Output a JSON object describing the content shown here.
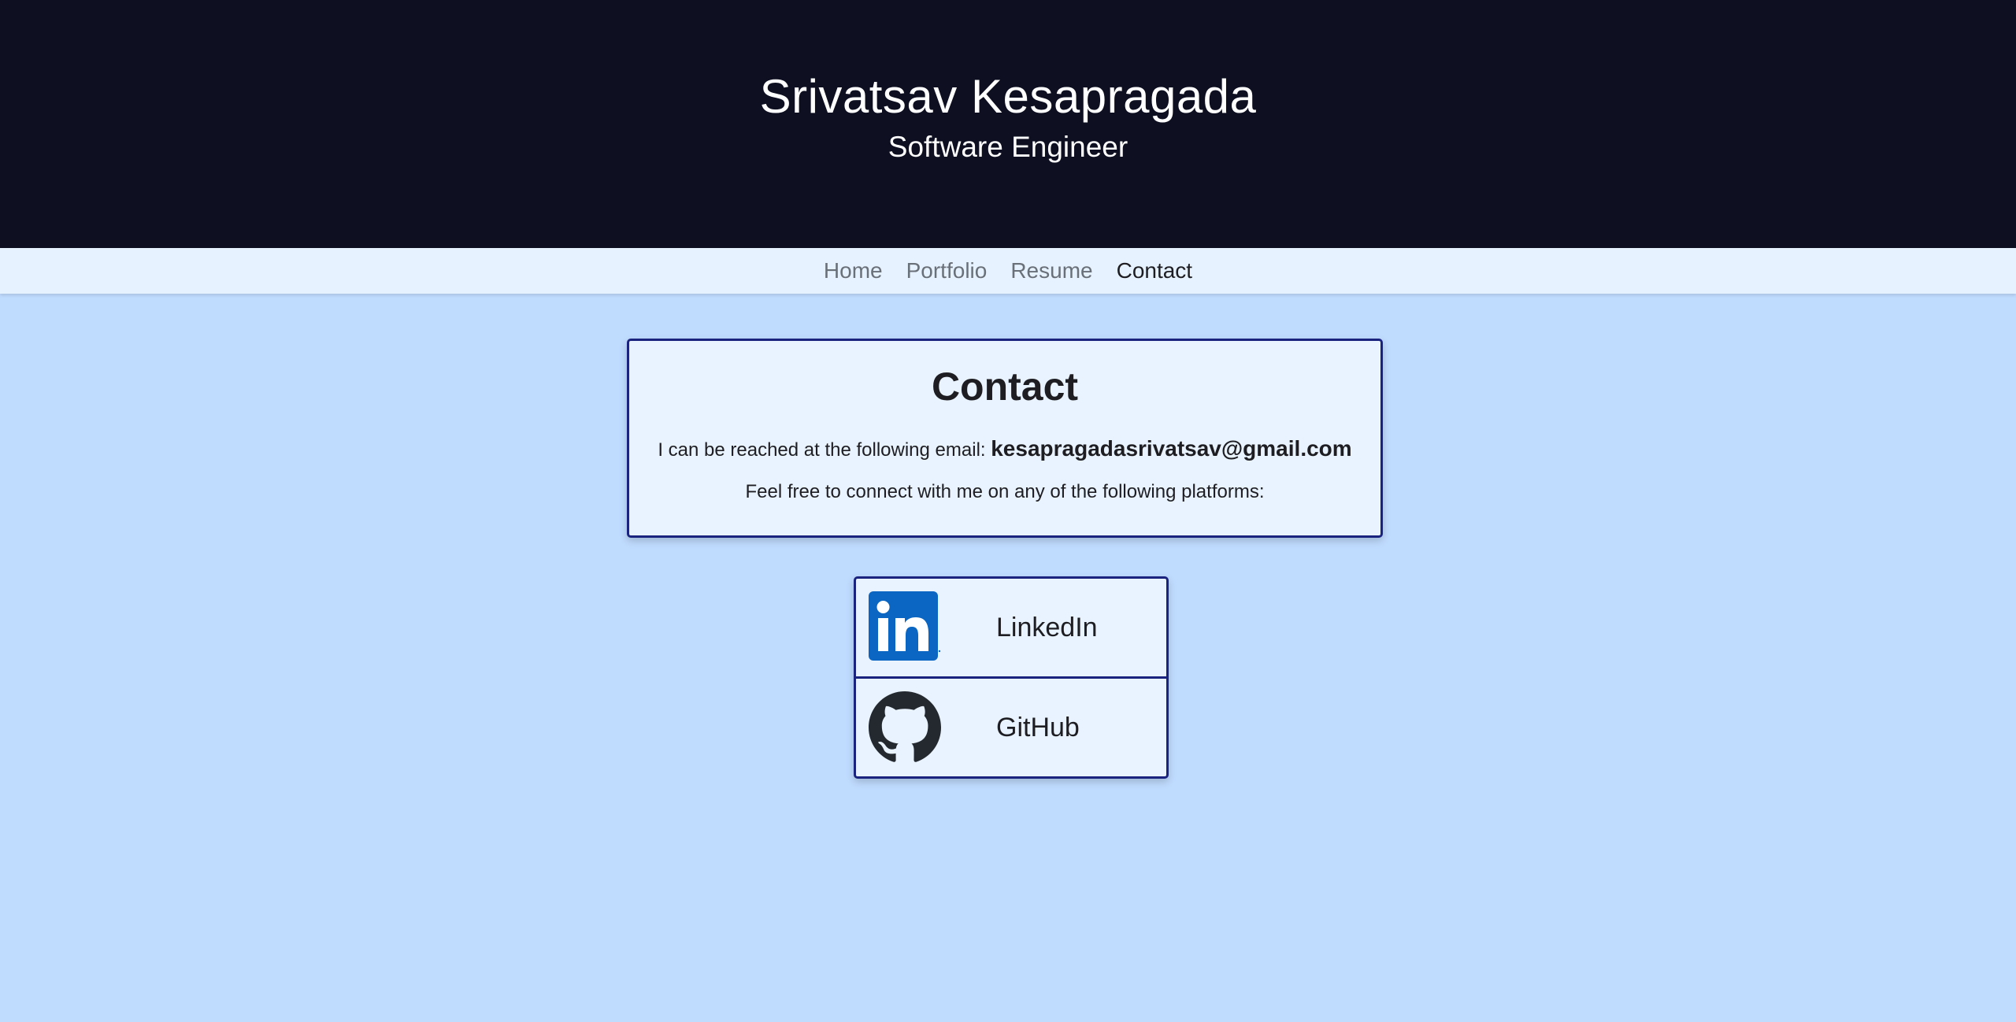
{
  "header": {
    "name": "Srivatsav Kesapragada",
    "title": "Software Engineer"
  },
  "nav": {
    "items": [
      {
        "label": "Home",
        "active": false
      },
      {
        "label": "Portfolio",
        "active": false
      },
      {
        "label": "Resume",
        "active": false
      },
      {
        "label": "Contact",
        "active": true
      }
    ]
  },
  "contact": {
    "heading": "Contact",
    "email_prefix": "I can be reached at the following email: ",
    "email": "kesapragadasrivatsav@gmail.com",
    "platforms_text": "Feel free to connect with me on any of the following platforms:"
  },
  "platforms": [
    {
      "label": "LinkedIn",
      "icon": "linkedin-icon"
    },
    {
      "label": "GitHub",
      "icon": "github-icon"
    }
  ],
  "colors": {
    "header_bg": "#0e1022",
    "nav_bg": "#e6f2ff",
    "page_bg": "#bfdbfe",
    "card_bg": "#e8f3ff",
    "card_border": "#1a237e",
    "linkedin_blue": "#0a66c2",
    "github_dark": "#24292f"
  }
}
